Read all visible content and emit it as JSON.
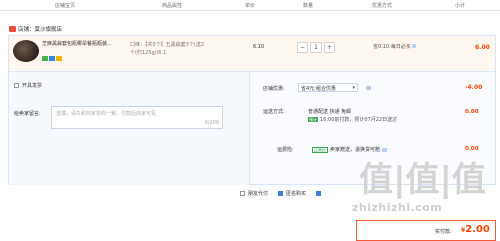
{
  "header": {
    "columns": [
      "店铺宝贝",
      "商品属性",
      "单价",
      "数量",
      "优惠方式",
      "小计"
    ]
  },
  "shop": {
    "label": "店铺：",
    "name": "莫沙旗舰店"
  },
  "item": {
    "title": "芝麻黑蒜套包瓶椰旱餐瓶瓶装...",
    "spec_line1": "口味：【共5个】五黑蒜套3个(送2",
    "spec_line2": "个(约125g/)6.1",
    "unit_price": "6.10",
    "quantity": "1",
    "minus": "−",
    "plus": "+",
    "promotion": "省0.10:每日必买",
    "subtotal": "6.00"
  },
  "left": {
    "invoice_label": "开具发票",
    "message_label": "给卖家留言:",
    "message_placeholder": "选填，请先和商家协商一致，付款后商家可见",
    "message_count": "0/200"
  },
  "discount": {
    "label": "店铺优惠:",
    "selected": "省4元:组合优惠",
    "amount": "-4.00"
  },
  "shipping": {
    "label": "运送方式:",
    "method": "普通配送 快递 免邮",
    "badge": "预计",
    "time": "16:00前付款，预计07月22日送达",
    "amount": "0.00"
  },
  "insurance": {
    "label": "运费险:",
    "tag": "运费险",
    "text": "卖家赠送，退换货可赔",
    "amount": "0.00"
  },
  "footer": {
    "anonymous_pay": "朋友代付",
    "anonymous_buy": "匿名购买",
    "third_check_label": ""
  },
  "watermark": {
    "glyphs": "值|值|值",
    "url": "zhizhizhi.com"
  },
  "total": {
    "label": "实付款:",
    "currency": "¥",
    "amount": "2.00"
  },
  "colors": {
    "accent_red": "#ff4400",
    "blue": "#3f82d8",
    "green": "#3aa35a"
  }
}
